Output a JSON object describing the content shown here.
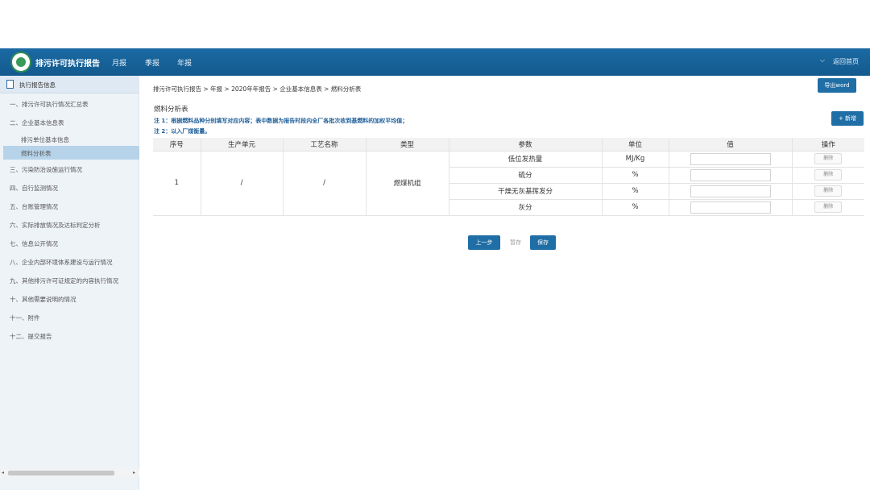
{
  "header": {
    "app_title": "排污许可执行报告",
    "nav": [
      "月报",
      "季报",
      "年报"
    ],
    "return_home": "返回首页",
    "chevron": "⌵"
  },
  "sidebar": {
    "head_label": "执行报告信息",
    "items": [
      "一、排污许可执行情况汇总表",
      "二、企业基本信息表",
      "排污单位基本信息",
      "燃料分析表",
      "三、污染防治设施运行情况",
      "四、自行监测情况",
      "五、台账管理情况",
      "六、实际排放情况及达标判定分析",
      "七、信息公开情况",
      "八、企业内部环境体系建设与运行情况",
      "九、其他排污许可证规定的内容执行情况",
      "十、其他需要说明的情况",
      "十一、附件",
      "十二、提交报告"
    ],
    "scroll_left": "◂",
    "scroll_right": "▸"
  },
  "breadcrumb": "排污许可执行报告 > 年报 > 2020年年报告 > 企业基本信息表 > 燃料分析表",
  "buttons": {
    "export": "导出word",
    "add": "+ 新增",
    "prev": "上一步",
    "draft": "暂存",
    "save": "保存"
  },
  "section": {
    "title": "燃料分析表",
    "note1": "注 1：根据燃料品种分别填写对应内容；表中数据为报告时段内全厂各批次收到基燃料的加权平均值；",
    "note2": "注 2：以入厂煤衡量。"
  },
  "table": {
    "headers": [
      "序号",
      "生产单元",
      "工艺名称",
      "类型",
      "参数",
      "单位",
      "值",
      "操作"
    ],
    "row": {
      "index": "1",
      "unit": "/",
      "process": "/",
      "type": "燃煤机组"
    },
    "params": [
      {
        "name": "低位发热量",
        "unit": "MJ/Kg",
        "value": ""
      },
      {
        "name": "硫分",
        "unit": "%",
        "value": ""
      },
      {
        "name": "干燥无灰基挥发分",
        "unit": "%",
        "value": ""
      },
      {
        "name": "灰分",
        "unit": "%",
        "value": ""
      }
    ],
    "delete_label": "删除"
  },
  "colors": {
    "header_bg": "#135a8e",
    "primary_button": "#1f6ea6",
    "note_text": "#1f5f99",
    "sidebar_bg": "#eef3f8",
    "sidebar_active": "#b6d3ea"
  }
}
